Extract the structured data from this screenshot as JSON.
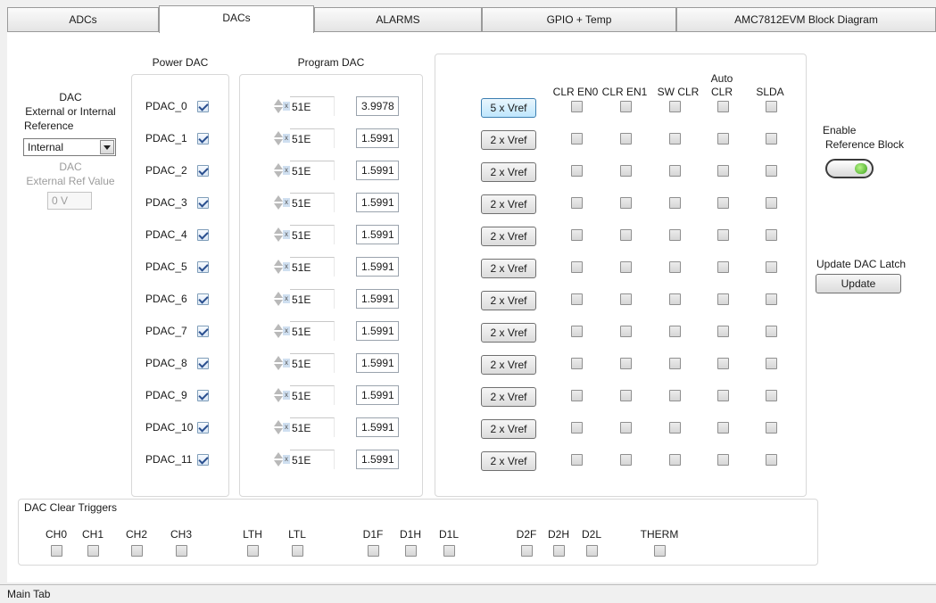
{
  "tabs": [
    "ADCs",
    "DACs",
    "ALARMS",
    "GPIO + Temp",
    "AMC7812EVM Block Diagram"
  ],
  "reference": {
    "heading_line1": "DAC",
    "heading_line2": "External or Internal",
    "heading_line3": "Reference",
    "selected": "Internal",
    "ext_label_line1": "DAC",
    "ext_label_line2": "External Ref Value",
    "ext_value": "0 V"
  },
  "power_dac": {
    "title": "Power DAC",
    "items": [
      {
        "label": "PDAC_0",
        "checked": true
      },
      {
        "label": "PDAC_1",
        "checked": true
      },
      {
        "label": "PDAC_2",
        "checked": true
      },
      {
        "label": "PDAC_3",
        "checked": true
      },
      {
        "label": "PDAC_4",
        "checked": true
      },
      {
        "label": "PDAC_5",
        "checked": true
      },
      {
        "label": "PDAC_6",
        "checked": true
      },
      {
        "label": "PDAC_7",
        "checked": true
      },
      {
        "label": "PDAC_8",
        "checked": true
      },
      {
        "label": "PDAC_9",
        "checked": true
      },
      {
        "label": "PDAC_10",
        "checked": true
      },
      {
        "label": "PDAC_11",
        "checked": true
      }
    ]
  },
  "program_dac": {
    "title": "Program DAC",
    "hex_prefix": "x",
    "codes": [
      "51E",
      "51E",
      "51E",
      "51E",
      "51E",
      "51E",
      "51E",
      "51E",
      "51E",
      "51E",
      "51E",
      "51E"
    ],
    "voltages": [
      "3.9978",
      "1.5991",
      "1.5991",
      "1.5991",
      "1.5991",
      "1.5991",
      "1.5991",
      "1.5991",
      "1.5991",
      "1.5991",
      "1.5991",
      "1.5991"
    ]
  },
  "gain": {
    "buttons": [
      "5 x Vref",
      "2 x Vref",
      "2 x Vref",
      "2 x Vref",
      "2 x Vref",
      "2 x Vref",
      "2 x Vref",
      "2 x Vref",
      "2 x Vref",
      "2 x Vref",
      "2 x Vref",
      "2 x Vref"
    ],
    "columns": [
      {
        "line1": "",
        "line2": "CLR EN0"
      },
      {
        "line1": "",
        "line2": "CLR EN1"
      },
      {
        "line1": "",
        "line2": "SW CLR"
      },
      {
        "line1": "Auto",
        "line2": "CLR"
      },
      {
        "line1": "",
        "line2": "SLDA"
      }
    ]
  },
  "enable_ref": {
    "line1": "Enable",
    "line2": "Reference Block"
  },
  "update": {
    "label": "Update DAC Latch",
    "button": "Update"
  },
  "clear_triggers": {
    "title": "DAC Clear Triggers",
    "items": [
      "CH0",
      "CH1",
      "CH2",
      "CH3",
      "LTH",
      "LTL",
      "D1F",
      "D1H",
      "D1L",
      "D2F",
      "D2H",
      "D2L",
      "THERM"
    ]
  },
  "status_text": "Main Tab",
  "colors": {
    "accent_button": "#bee6fd",
    "led_on": "#3aa21b"
  }
}
